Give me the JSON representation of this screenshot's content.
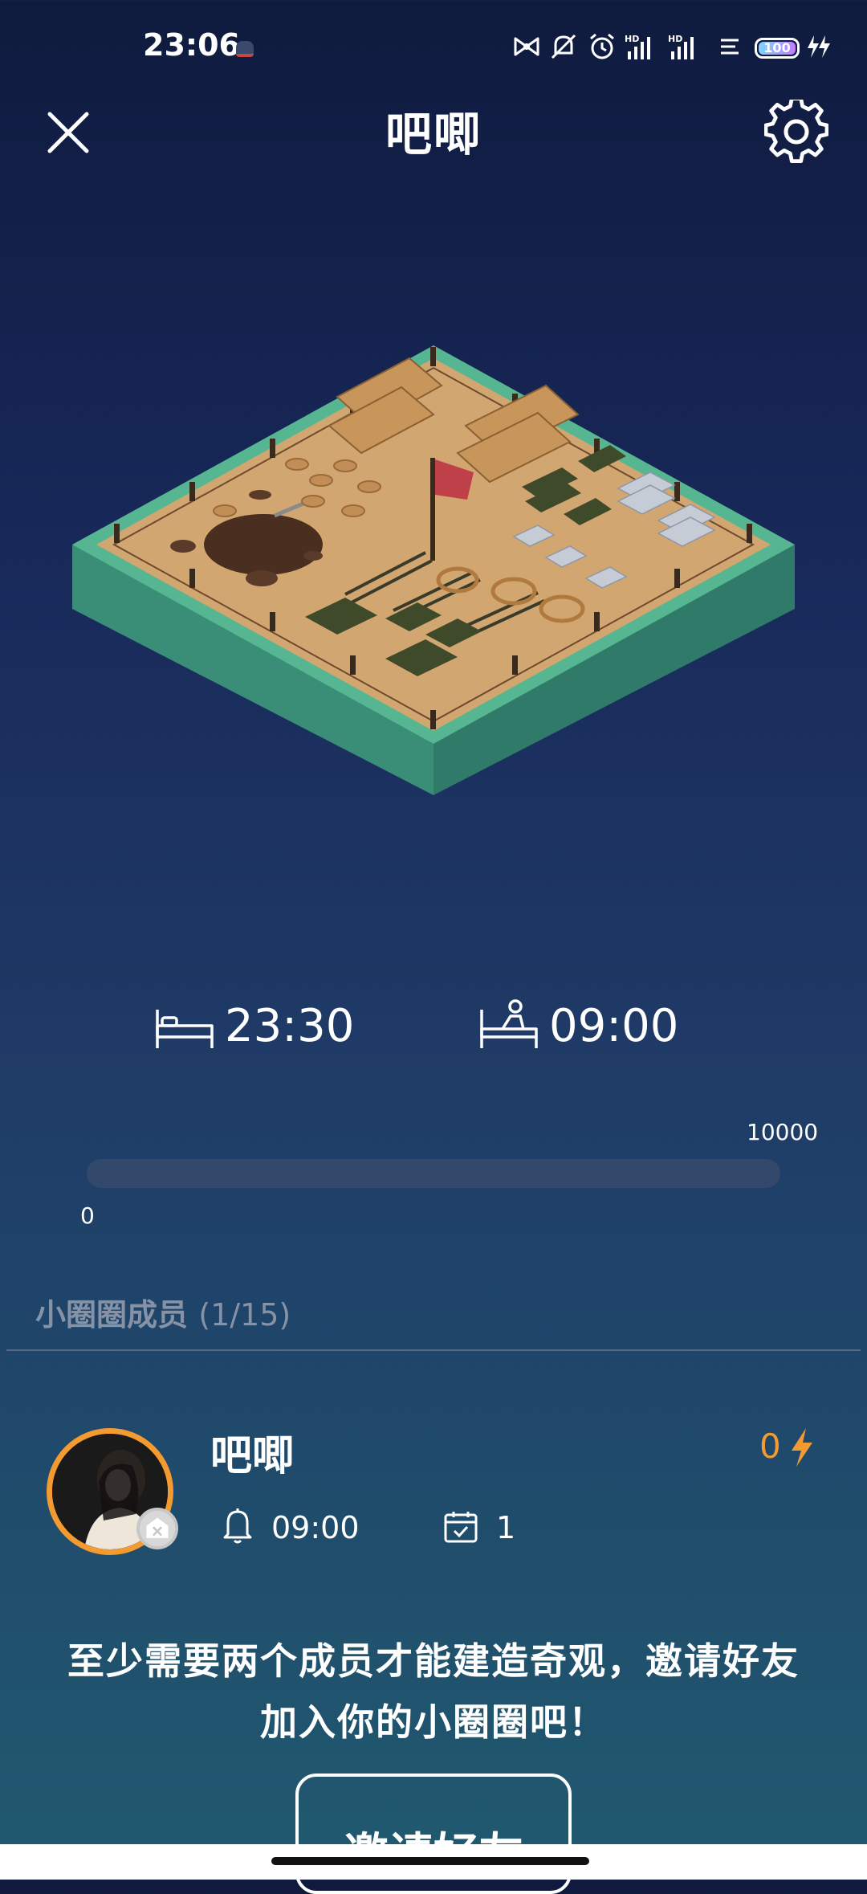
{
  "status_bar": {
    "time": "23:06",
    "battery_level": "100",
    "icons": [
      "bow-icon",
      "bell-muted-icon",
      "alarm-icon",
      "signal-hd-1-icon",
      "signal-hd-2-icon",
      "data-icon",
      "battery-icon",
      "charging-icon"
    ]
  },
  "header": {
    "title": "吧唧",
    "close_icon": "close-icon",
    "settings_icon": "gear-icon"
  },
  "scene": {
    "description_icon": "construction-site-illustration",
    "flag_color": "#c0404a",
    "ground_color": "#d2a670",
    "base_color": "#3e9a82"
  },
  "sleep": {
    "bedtime": "23:30",
    "wake_time": "09:00"
  },
  "progress": {
    "min": "0",
    "max": "10000",
    "current": 0
  },
  "members": {
    "heading": "小圈圈成员",
    "count": "(1/15)",
    "list": [
      {
        "name": "吧唧",
        "energy": "0",
        "alarm": "09:00",
        "days": "1"
      }
    ]
  },
  "invite": {
    "message_line1": "至少需要两个成员才能建造奇观，邀请好友",
    "message_line2": "加入你的小圈圈吧！",
    "button_label": "邀请好友"
  },
  "colors": {
    "accent": "#f39a30",
    "muted_text": "#8692a6"
  }
}
